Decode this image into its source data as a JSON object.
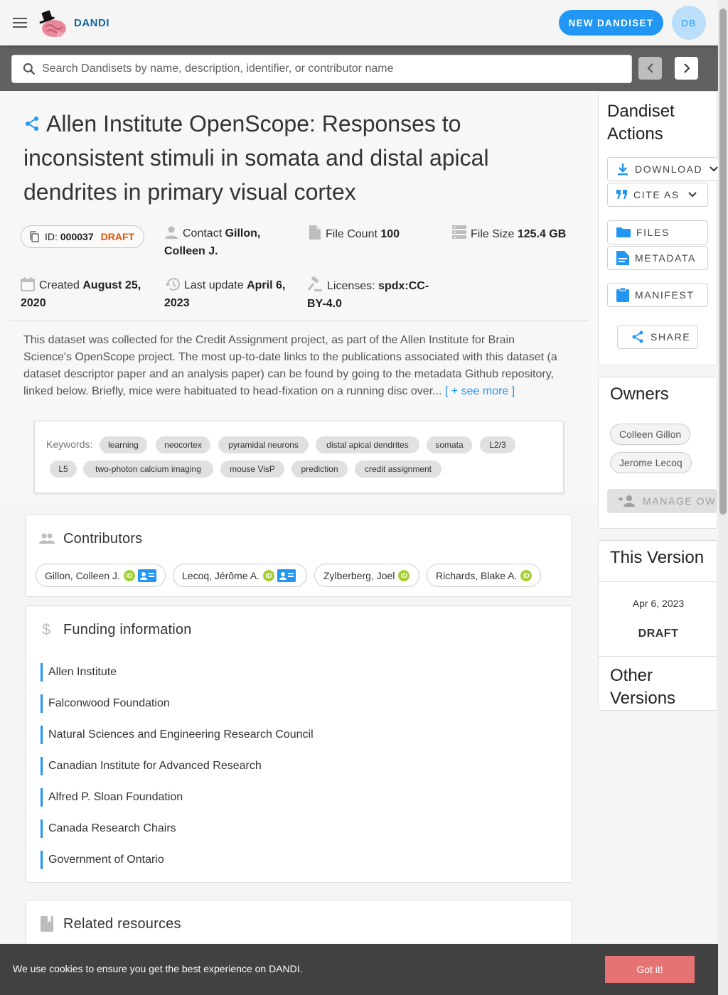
{
  "header": {
    "brand": "DANDI",
    "new_button": "NEW DANDISET",
    "avatar_initials": "DB"
  },
  "search": {
    "placeholder": "Search Dandisets by name, description, identifier, or contributor name"
  },
  "dandiset": {
    "title": "Allen Institute OpenScope: Responses to inconsistent stimuli in somata and distal apical dendrites in primary visual cortex",
    "id_label": "ID:",
    "id_value": "000037",
    "status": "DRAFT",
    "contact_label": "Contact",
    "contact_value": "Gillon, Colleen J.",
    "file_count_label": "File Count",
    "file_count_value": "100",
    "file_size_label": "File Size",
    "file_size_value": "125.4 GB",
    "created_label": "Created",
    "created_value": "August 25, 2020",
    "updated_label": "Last update",
    "updated_value": "April 6, 2023",
    "license_label": "Licenses:",
    "license_value": "spdx:CC-BY-4.0",
    "description": "This dataset was collected for the Credit Assignment project, as part of the Allen Institute for Brain Science's OpenScope project. The most up-to-date links to the publications associated with this dataset (a dataset descriptor paper and an analysis paper) can be found by going to the metadata Github repository, linked below. Briefly, mice were habituated to head-fixation on a running disc over...",
    "see_more": "[ + see more ]"
  },
  "keywords": {
    "label": "Keywords:",
    "items": [
      "learning",
      "neocortex",
      "pyramidal neurons",
      "distal apical dendrites",
      "somata",
      "L2/3",
      "L5",
      "two-photon calcium imaging",
      "mouse VisP",
      "prediction",
      "credit assignment"
    ]
  },
  "contributors": {
    "title": "Contributors",
    "items": [
      "Gillon, Colleen J.",
      "Lecoq, Jérôme A.",
      "Zylberberg, Joel",
      "Richards, Blake A."
    ],
    "orcid_badge": "iD"
  },
  "funding": {
    "title": "Funding information",
    "items": [
      "Allen Institute",
      "Falconwood Foundation",
      "Natural Sciences and Engineering Research Council",
      "Canadian Institute for Advanced Research",
      "Alfred P. Sloan Foundation",
      "Canada Research Chairs",
      "Government of Ontario"
    ]
  },
  "related": {
    "title": "Related resources"
  },
  "actions": {
    "title": "Dandiset Actions",
    "download": "DOWNLOAD",
    "cite": "CITE AS",
    "files": "FILES",
    "metadata": "METADATA",
    "manifest": "MANIFEST",
    "share": "SHARE"
  },
  "owners": {
    "title": "Owners",
    "items": [
      "Colleen Gillon",
      "Jerome Lecoq"
    ],
    "manage": "MANAGE OWNERS"
  },
  "version": {
    "title": "This Version",
    "date": "Apr 6, 2023",
    "status": "DRAFT",
    "other_title": "Other Versions"
  },
  "cookie": {
    "text": "We use cookies to ensure you get the best experience on DANDI.",
    "button": "Got it!"
  },
  "colors": {
    "accent": "#2196f3",
    "draft": "#e65100",
    "orcid": "#a6ce39",
    "cookie_button": "#e57373"
  }
}
